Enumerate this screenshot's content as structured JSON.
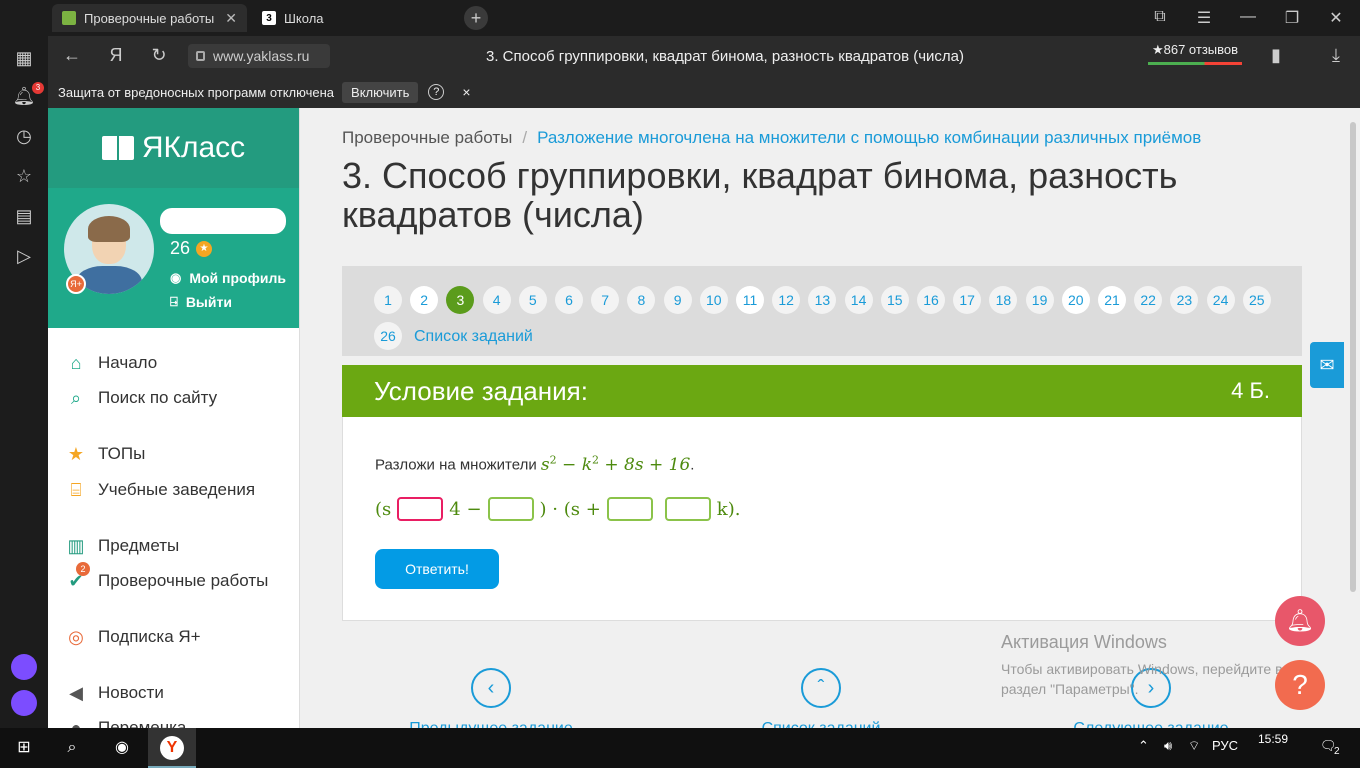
{
  "browser": {
    "tabs": [
      {
        "label": "Проверочные работы"
      },
      {
        "label": "Школа"
      }
    ],
    "url": "www.yaklass.ru",
    "page_title": "3. Способ группировки, квадрат бинома, разность квадратов (числа)",
    "reviews": "★867 отзывов",
    "protection": {
      "message": "Защита от вредоносных программ отключена",
      "enable_label": "Включить",
      "help": "?",
      "close": "×"
    },
    "sidebar_badge": "3"
  },
  "site": {
    "logo": "ЯКласс",
    "profile": {
      "points": "26",
      "my_profile": "Мой профиль",
      "logout": "Выйти"
    },
    "menu": [
      {
        "label": "Начало",
        "icon": "home-icon"
      },
      {
        "label": "Поиск по сайту",
        "icon": "search-icon"
      },
      {
        "label": "ТОПы",
        "icon": "star-icon"
      },
      {
        "label": "Учебные заведения",
        "icon": "institution-icon"
      },
      {
        "label": "Предметы",
        "icon": "books-icon"
      },
      {
        "label": "Проверочные работы",
        "icon": "check-icon",
        "badge": "2"
      },
      {
        "label": "Подписка Я+",
        "icon": "subscription-icon"
      },
      {
        "label": "Новости",
        "icon": "megaphone-icon"
      },
      {
        "label": "Переменка",
        "icon": "break-icon"
      }
    ]
  },
  "main": {
    "breadcrumb": {
      "root": "Проверочные работы",
      "separator": "/",
      "current": "Разложение многочлена на множители с помощью комбинации различных приёмов"
    },
    "title": "3. Способ группировки, квадрат бинома, разность квадратов (числа)",
    "pager": {
      "pages": [
        "1",
        "2",
        "3",
        "4",
        "5",
        "6",
        "7",
        "8",
        "9",
        "10",
        "11",
        "12",
        "13",
        "14",
        "15",
        "16",
        "17",
        "18",
        "19",
        "20",
        "21",
        "22",
        "23",
        "24",
        "25",
        "26"
      ],
      "active": "3",
      "task_list": "Список заданий"
    },
    "condition": {
      "header": "Условие задания:",
      "points": "4 Б.",
      "prompt": "Разложи на множители",
      "expr": {
        "a": "s",
        "e1": "2",
        "op1": " − ",
        "b": "k",
        "e2": "2",
        "rest": " + 8s + 16",
        "end": "."
      },
      "answer_row": {
        "p1": "(s",
        "p2": "4 −",
        "p3": ") · (s +",
        "p4": "k)."
      },
      "submit": "Ответить!"
    },
    "nav": {
      "prev": "Предыдущее задание",
      "list": "Список заданий",
      "next": "Следующее задание"
    }
  },
  "watermark": {
    "title": "Активация Windows",
    "line1": "Чтобы активировать Windows, перейдите в",
    "line2": "раздел \"Параметры\"."
  },
  "taskbar": {
    "lang": "РУС",
    "time": "15:59",
    "notifications": "2"
  },
  "colors": {
    "brand_green": "#239b7f",
    "accent_green": "#6ba812",
    "link_blue": "#1a9bd8",
    "button_blue": "#039be5"
  }
}
